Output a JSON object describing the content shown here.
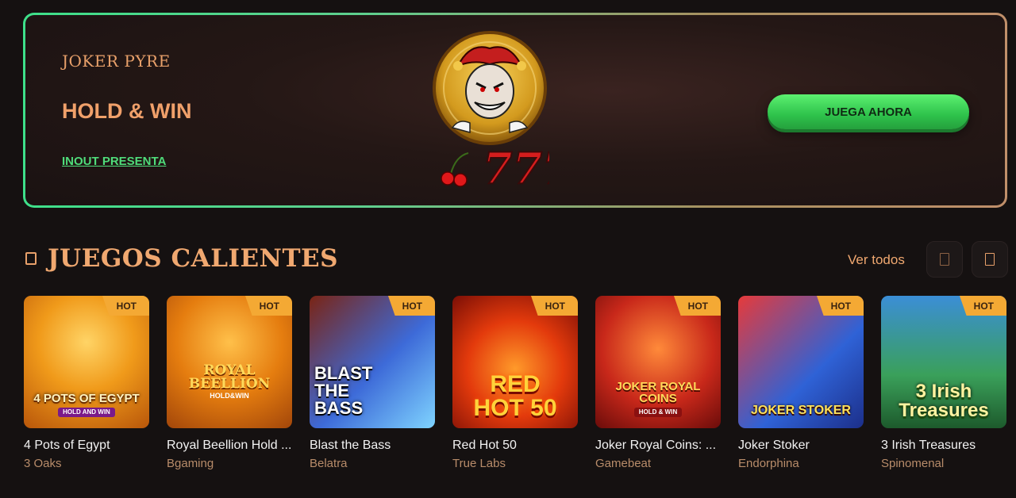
{
  "banner": {
    "subtitle": "JOKER PYRE",
    "title": "HOLD & WIN",
    "presenter": "INOUT PRESENTA",
    "cta_label": "JUEGA AHORA",
    "logo_icon": "joker-777-logo-icon"
  },
  "section": {
    "title": "JUEGOS CALIENTES",
    "see_all": "Ver todos",
    "icon": "fire-icon",
    "prev_icon": "arrow-left-icon",
    "next_icon": "arrow-right-icon"
  },
  "games": [
    {
      "tag": "HOT",
      "art": "4 POTS OF EGYPT",
      "art_sub": "HOLD AND WIN",
      "name": "4 Pots of Egypt",
      "provider": "3 Oaks"
    },
    {
      "tag": "HOT",
      "art": "ROYAL BEELLION",
      "art_sub": "HOLD&WIN",
      "name": "Royal Beellion Hold ...",
      "provider": "Bgaming"
    },
    {
      "tag": "HOT",
      "art": "BLAST THE BASS",
      "art_sub": "",
      "name": "Blast the Bass",
      "provider": "Belatra"
    },
    {
      "tag": "HOT",
      "art": "RED HOT 50",
      "art_sub": "",
      "name": "Red Hot 50",
      "provider": "True Labs"
    },
    {
      "tag": "HOT",
      "art": "JOKER ROYAL COINS",
      "art_sub": "HOLD & WIN",
      "name": "Joker Royal Coins: ...",
      "provider": "Gamebeat"
    },
    {
      "tag": "HOT",
      "art": "JOKER STOKER",
      "art_sub": "",
      "name": "Joker Stoker",
      "provider": "Endorphina"
    },
    {
      "tag": "HOT",
      "art": "3 Irish Treasures",
      "art_sub": "",
      "name": "3 Irish Treasures",
      "provider": "Spinomenal"
    }
  ],
  "colors": {
    "accent_orange": "#f0a870",
    "accent_green": "#4fdc7a",
    "hot_tag": "#f4a934",
    "background": "#151111"
  }
}
